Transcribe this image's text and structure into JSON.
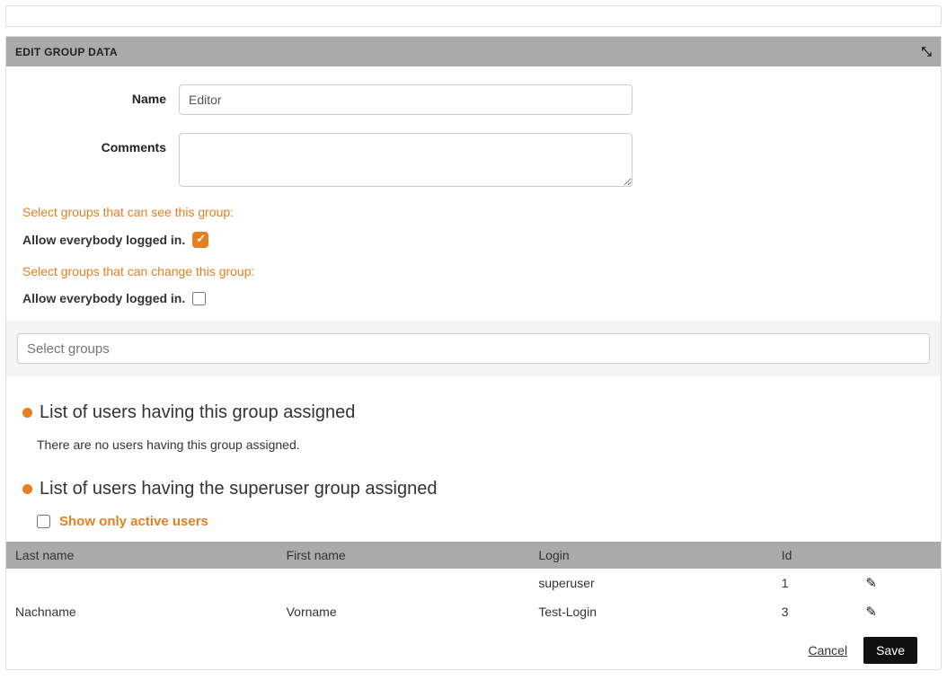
{
  "panel": {
    "title": "EDIT GROUP DATA"
  },
  "form": {
    "name_label": "Name",
    "name_value": "Editor",
    "comments_label": "Comments",
    "comments_value": ""
  },
  "perm_see": {
    "heading": "Select groups that can see this group:",
    "allow_label": "Allow everybody logged in."
  },
  "perm_change": {
    "heading": "Select groups that can change this group:",
    "allow_label": "Allow everybody logged in."
  },
  "select_groups_placeholder": "Select groups",
  "section_assigned": {
    "title": "List of users having this group assigned",
    "empty": "There are no users having this group assigned."
  },
  "section_superuser": {
    "title": "List of users having the superuser group assigned",
    "show_active": "Show only active users"
  },
  "table": {
    "headers": {
      "lastname": "Last name",
      "firstname": "First name",
      "login": "Login",
      "id": "Id"
    },
    "rows": [
      {
        "lastname": "",
        "firstname": "",
        "login": "superuser",
        "id": "1"
      },
      {
        "lastname": "Nachname",
        "firstname": "Vorname",
        "login": "Test-Login",
        "id": "3"
      }
    ]
  },
  "actions": {
    "cancel": "Cancel",
    "save": "Save"
  }
}
